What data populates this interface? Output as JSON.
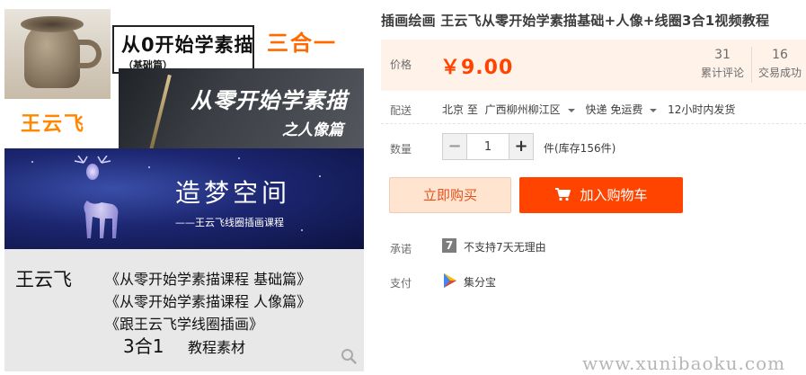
{
  "gallery": {
    "panel1_title": "从0开始学素描",
    "panel1_subtitle": "（基础篇）",
    "three_in_one": "三合一",
    "author_orange": "王云飞",
    "panel2_title": "从零开始学素描",
    "panel2_subtitle": "之人像篇",
    "panel3_title": "造梦空间",
    "panel3_subtitle": "——王云飞线圈插画课程",
    "panel4_author": "王云飞",
    "panel4_lines": [
      "《从零开始学素描课程 基础篇》",
      "《从零开始学素描课程 人像篇》",
      "《跟王云飞学线圈插画》"
    ],
    "panel4_combo": "3合1",
    "panel4_material": "教程素材"
  },
  "product": {
    "title": "插画绘画 王云飞从零开始学素描基础+人像+线圈3合1视频教程"
  },
  "price": {
    "label": "价格",
    "value": "￥9.00",
    "stats": [
      {
        "num": "31",
        "label": "累计评论"
      },
      {
        "num": "16",
        "label": "交易成功"
      }
    ]
  },
  "shipping": {
    "label": "配送",
    "from": "北京 至",
    "to": "广西柳州柳江区",
    "method": "快递 免运费",
    "time": "12小时内发货"
  },
  "quantity": {
    "label": "数量",
    "minus": "−",
    "plus": "+",
    "value": "1",
    "stock": "件(库存156件)"
  },
  "actions": {
    "buy_now": "立即购买",
    "add_cart": "加入购物车"
  },
  "promise": {
    "label": "承诺",
    "icon_text": "7",
    "text": "不支持7天无理由"
  },
  "payment": {
    "label": "支付",
    "text": "集分宝"
  },
  "watermark": "www.xunibaoku.com",
  "colors": {
    "accent": "#ff4400",
    "price_bg": "#fff2e8",
    "buy_now_bg": "#ffe4d0"
  }
}
